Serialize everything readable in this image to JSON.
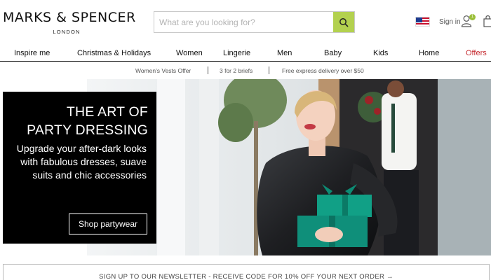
{
  "header": {
    "logo": {
      "main": "MARKS & SPENCER",
      "sub": "LONDON"
    },
    "search": {
      "placeholder": "What are you looking for?",
      "value": "",
      "icon": "search-icon"
    },
    "country_flag": "us-flag-icon",
    "signin_label": "Sign in",
    "account_badge": "1",
    "bag_icon": "shopping-bag-icon"
  },
  "nav": {
    "items": [
      "Inspire me",
      "Christmas & Holidays",
      "Women",
      "Lingerie",
      "Men",
      "Baby",
      "Kids",
      "Home",
      "Offers"
    ]
  },
  "promo_bar": {
    "items": [
      "Women's Vests Offer",
      "3 for 2 briefs",
      "Free express delivery over $50"
    ]
  },
  "hero": {
    "title_line1": "THE ART OF",
    "title_line2": "PARTY DRESSING",
    "subtitle": "Upgrade your after-dark looks with fabulous dresses, suave suits and chic accessories",
    "cta": "Shop partywear"
  },
  "newsletter": {
    "text": "SIGN UP TO OUR NEWSLETTER - RECEIVE CODE FOR 10% OFF YOUR NEXT ORDER →"
  },
  "colors": {
    "accent": "#b3d14f",
    "offers": "#c5282d",
    "hero_box": "#000000"
  }
}
